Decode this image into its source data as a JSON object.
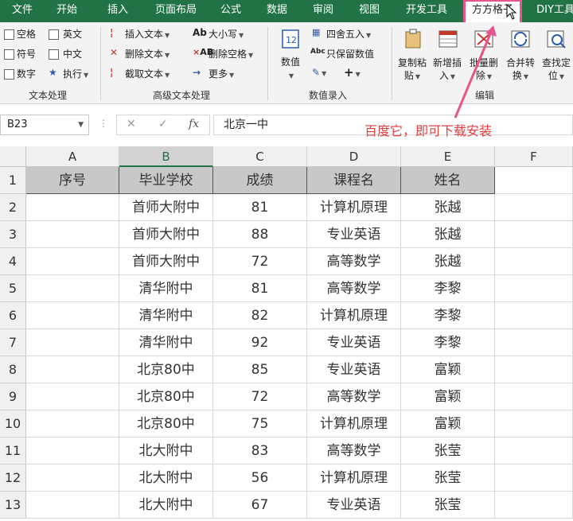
{
  "tabs": [
    "文件",
    "开始",
    "插入",
    "页面布局",
    "公式",
    "数据",
    "审阅",
    "视图",
    "开发工具",
    "方方格子",
    "DIY工具"
  ],
  "ribbon": {
    "text_group": {
      "checkboxes": [
        "空格",
        "英文",
        "符号",
        "中文",
        "数字"
      ],
      "execute": "执行",
      "label": "文本处理"
    },
    "advanced_group": {
      "items": [
        "插入文本",
        "删除文本",
        "截取文本",
        "大小写",
        "删除空格",
        "更多"
      ],
      "label": "高级文本处理"
    },
    "number_group": {
      "value_btn": "数值",
      "items": [
        "四舍五入",
        "只保留数值"
      ],
      "label": "数值录入"
    },
    "edit_group": {
      "buttons": [
        {
          "line1": "复制粘",
          "line2": "贴"
        },
        {
          "line1": "新增插",
          "line2": "入"
        },
        {
          "line1": "批量删",
          "line2": "除"
        },
        {
          "line1": "合并转",
          "line2": "换"
        },
        {
          "line1": "查找定",
          "line2": "位"
        }
      ],
      "label": "编辑"
    }
  },
  "formula_bar": {
    "name_box": "B23",
    "cancel": "✕",
    "confirm": "✓",
    "fx": "fx",
    "content": "北京一中"
  },
  "annotation": "百度它，即可下载安装",
  "columns": [
    "A",
    "B",
    "C",
    "D",
    "E",
    "F"
  ],
  "row_numbers": [
    "1",
    "2",
    "3",
    "4",
    "5",
    "6",
    "7",
    "8",
    "9",
    "10",
    "11",
    "12",
    "13"
  ],
  "header_row": [
    "序号",
    "毕业学校",
    "成绩",
    "课程名",
    "姓名"
  ],
  "rows": [
    [
      "",
      "首师大附中",
      "81",
      "计算机原理",
      "张越"
    ],
    [
      "",
      "首师大附中",
      "88",
      "专业英语",
      "张越"
    ],
    [
      "",
      "首师大附中",
      "72",
      "高等数学",
      "张越"
    ],
    [
      "",
      "清华附中",
      "81",
      "高等数学",
      "李黎"
    ],
    [
      "",
      "清华附中",
      "82",
      "计算机原理",
      "李黎"
    ],
    [
      "",
      "清华附中",
      "92",
      "专业英语",
      "李黎"
    ],
    [
      "",
      "北京80中",
      "85",
      "专业英语",
      "富颖"
    ],
    [
      "",
      "北京80中",
      "72",
      "高等数学",
      "富颖"
    ],
    [
      "",
      "北京80中",
      "75",
      "计算机原理",
      "富颖"
    ],
    [
      "",
      "北大附中",
      "83",
      "高等数学",
      "张莹"
    ],
    [
      "",
      "北大附中",
      "56",
      "计算机原理",
      "张莹"
    ],
    [
      "",
      "北大附中",
      "67",
      "专业英语",
      "张莹"
    ]
  ],
  "colors": {
    "accent": "#217346",
    "highlight": "#e8548d",
    "annotation": "#e53c3c"
  }
}
